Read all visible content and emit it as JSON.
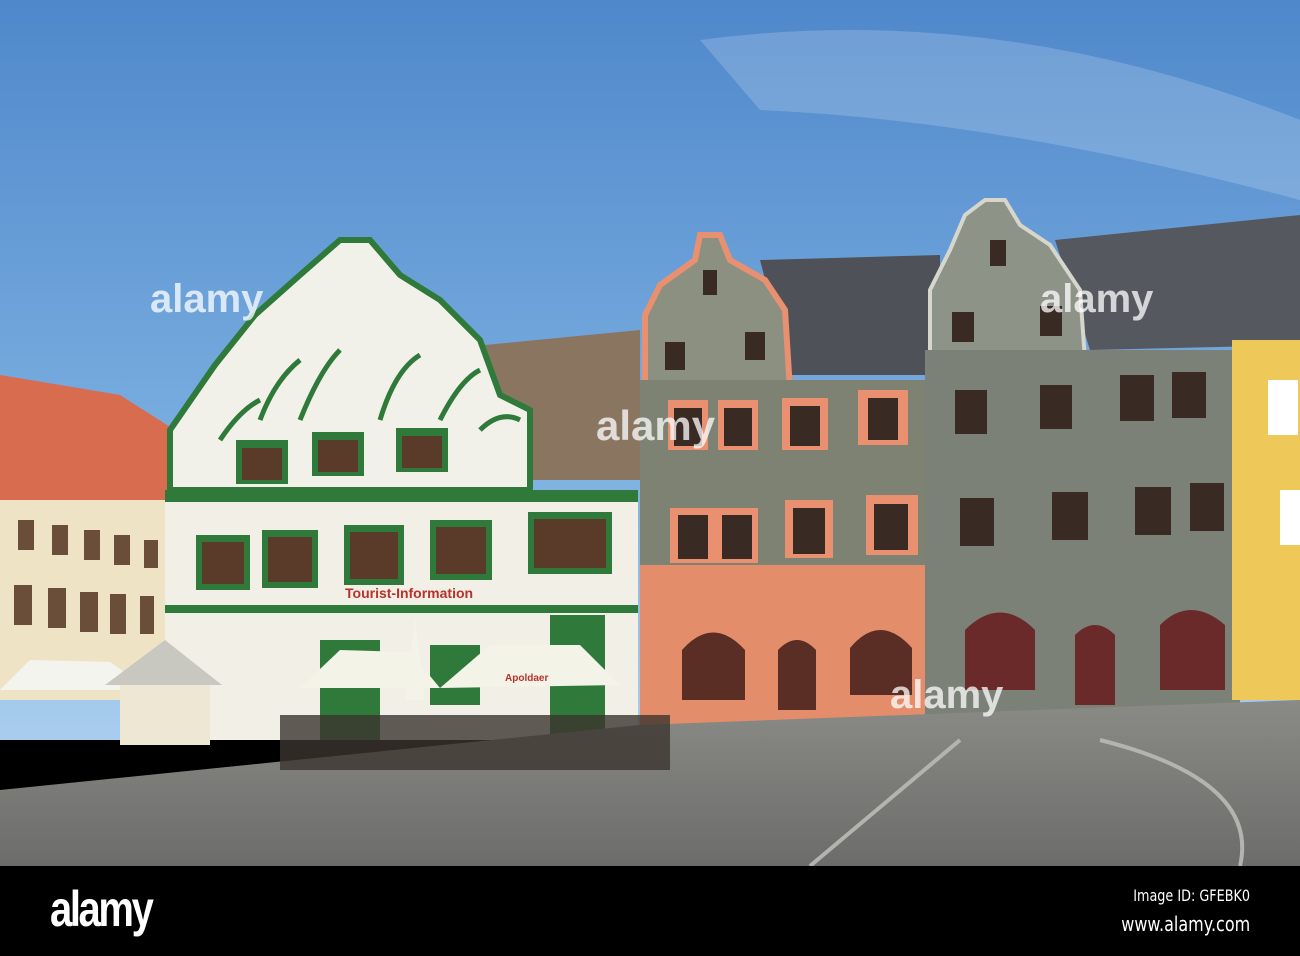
{
  "photo": {
    "signs": {
      "tourist_information": "Tourist-Information",
      "umbrella_brand": "Apoldaer"
    },
    "watermark": "alamy"
  },
  "footer": {
    "logo": "alamy",
    "image_id": "Image ID: GFEBK0",
    "url": "www.alamy.com"
  },
  "colors": {
    "sky": "#5e95d2",
    "green_trim": "#2f7a3a",
    "salmon_trim": "#e89070",
    "grey_facade": "#7d8272",
    "cobblestone": "#7a7a78"
  }
}
